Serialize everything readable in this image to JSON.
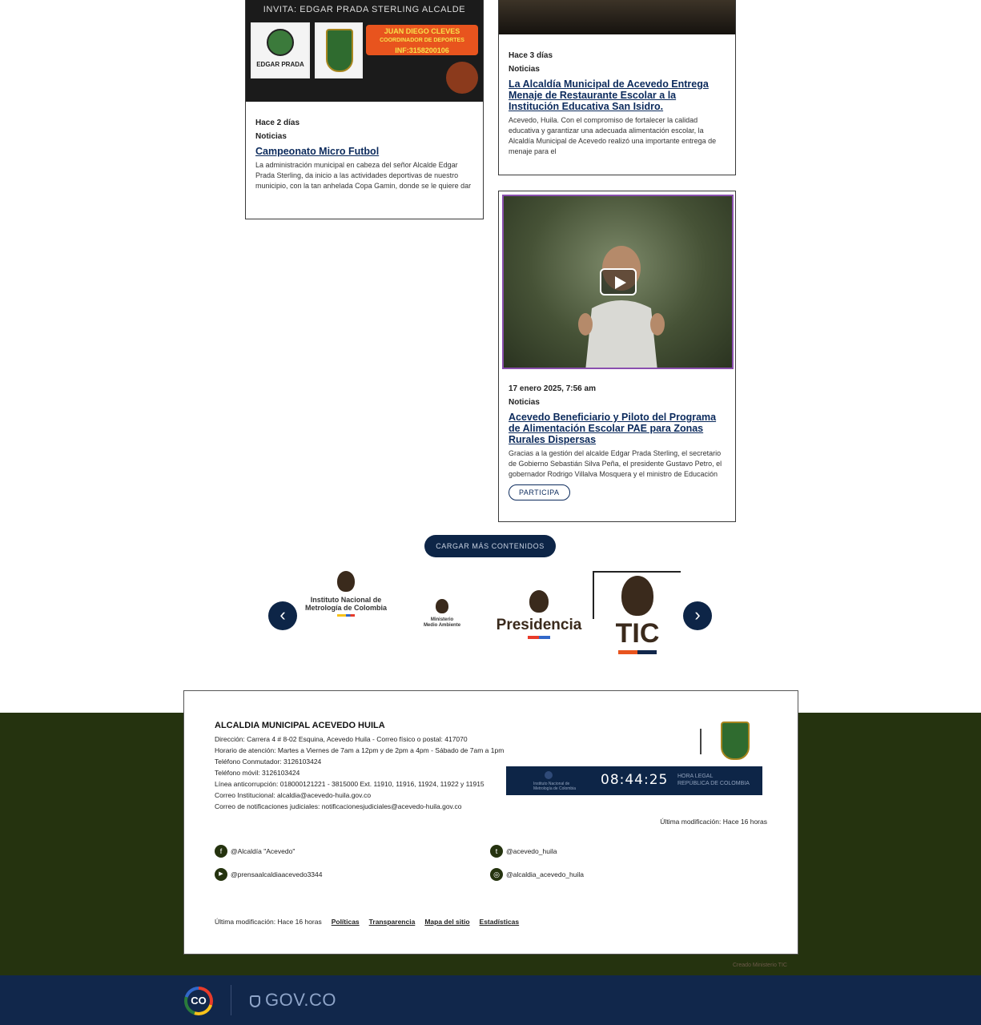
{
  "cards": [
    {
      "poster_invite": "INVITA: EDGAR PRADA STERLING ALCALDE",
      "poster_logo_text": "EDGAR PRADA",
      "poster_coordinator": "JUAN DIEGO CLEVES",
      "poster_coordinator_role": "COORDINADOR DE DEPORTES",
      "poster_phone": "INF:3158200106",
      "date": "Hace 2 días",
      "category": "Noticias",
      "title": "Campeonato Micro Futbol",
      "description": "La administración municipal en cabeza del señor Alcalde Edgar Prada Sterling, da inicio a las actividades deportivas de nuestro municipio, con la tan anhelada Copa Gamin, donde se le quiere dar"
    },
    {
      "date": "Hace 3 días",
      "category": "Noticias",
      "title": "La Alcaldía Municipal de Acevedo Entrega Menaje de Restaurante Escolar a la Institución Educativa San Isidro.",
      "description": "Acevedo, Huila. Con el compromiso de fortalecer la calidad educativa y garantizar una adecuada alimentación escolar, la Alcaldía Municipal de Acevedo realizó una importante entrega de menaje para el"
    },
    {
      "date": "17 enero 2025, 7:56 am",
      "category": "Noticias",
      "title": "Acevedo Beneficiario y Piloto del Programa de Alimentación Escolar PAE para Zonas Rurales Dispersas",
      "description": "Gracias a la gestión del alcalde Edgar Prada Sterling, el secretario de Gobierno Sebastián Silva Peña, el presidente Gustavo Petro, el gobernador Rodrigo Villalva Mosquera y el ministro de Educación",
      "button": "PARTICIPA"
    }
  ],
  "load_more": "CARGAR MÁS CONTENIDOS",
  "carousel": {
    "items": [
      {
        "line1": "Instituto Nacional de",
        "line2": "Metrología de Colombia"
      },
      {
        "line1": "Ministerio",
        "line2": "Medio Ambiente"
      },
      {
        "line1": "Presidencia",
        "line2": ""
      },
      {
        "line1": "TIC",
        "line2": ""
      }
    ],
    "prev": "‹",
    "next": "›"
  },
  "footer": {
    "entity": "ALCALDIA MUNICIPAL ACEVEDO HUILA",
    "lines": [
      "Dirección: Carrera 4 # 8-02 Esquina, Acevedo Huila - Correo físico o postal: 417070",
      "Horario de atención: Martes a Viernes de 7am a 12pm y de 2pm a 4pm - Sábado de 7am a 1pm",
      "Teléfono Conmutador: 3126103424",
      "Teléfono móvil: 3126103424",
      "Línea anticorrupción: 018000121221 - 3815000 Ext. 11910, 11916, 11924, 11922 y 11915",
      "Correo Institucional: alcaldia@acevedo-huila.gov.co",
      "Correo de notificaciones judiciales: notificacionesjudiciales@acevedo-huila.gov.co"
    ],
    "clock_time": "08:44:25",
    "clock_label_1": "HORA LEGAL",
    "clock_label_2": "REPÚBLICA DE COLOMBIA",
    "clock_inst": "Instituto Nacional de Metrología de Colombia",
    "last_mod_right": "Última modificación: Hace 16 horas",
    "social": [
      {
        "icon": "facebook-icon",
        "glyph": "f",
        "label": "@Alcaldía \"Acevedo\""
      },
      {
        "icon": "twitter-icon",
        "glyph": "t",
        "label": "@acevedo_huila"
      },
      {
        "icon": "youtube-icon",
        "glyph": "▶",
        "label": "@prensaalcaldiaacevedo3344"
      },
      {
        "icon": "instagram-icon",
        "glyph": "◎",
        "label": "@alcaldia_acevedo_huila"
      }
    ],
    "last_mod_bottom": "Última modificación: Hace 16 horas",
    "links": [
      "Políticas",
      "Transparencia",
      "Mapa del sitio",
      "Estadísticas"
    ],
    "credit": "Creado Ministerio TIC"
  },
  "govbar": {
    "co": "CO",
    "gov": "GOV.CO"
  },
  "colors": {
    "navy": "#0d2547",
    "footer_green": "#25330f",
    "accent_orange": "#e8541e"
  }
}
